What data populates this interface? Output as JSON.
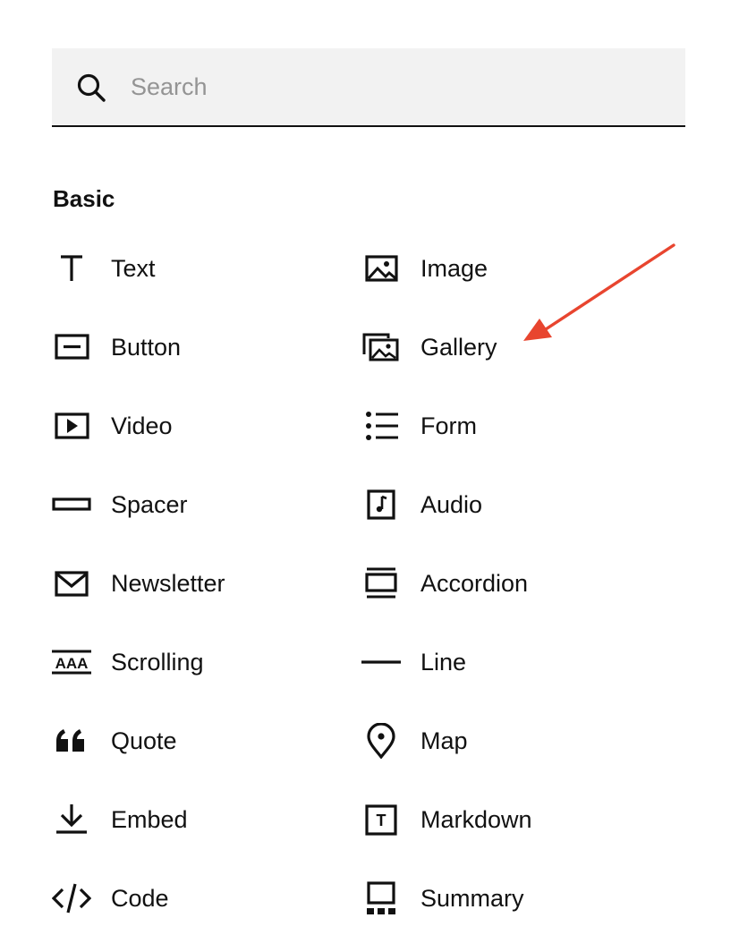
{
  "search": {
    "placeholder": "Search",
    "value": ""
  },
  "section": {
    "title": "Basic"
  },
  "blocks": {
    "text": {
      "label": "Text",
      "icon": "text-icon"
    },
    "image": {
      "label": "Image",
      "icon": "image-icon"
    },
    "button": {
      "label": "Button",
      "icon": "button-icon"
    },
    "gallery": {
      "label": "Gallery",
      "icon": "gallery-icon"
    },
    "video": {
      "label": "Video",
      "icon": "video-icon"
    },
    "form": {
      "label": "Form",
      "icon": "form-icon"
    },
    "spacer": {
      "label": "Spacer",
      "icon": "spacer-icon"
    },
    "audio": {
      "label": "Audio",
      "icon": "audio-icon"
    },
    "newsletter": {
      "label": "Newsletter",
      "icon": "newsletter-icon"
    },
    "accordion": {
      "label": "Accordion",
      "icon": "accordion-icon"
    },
    "scrolling": {
      "label": "Scrolling",
      "icon": "scrolling-icon",
      "icon_text": "AAA"
    },
    "line": {
      "label": "Line",
      "icon": "line-icon"
    },
    "quote": {
      "label": "Quote",
      "icon": "quote-icon"
    },
    "map": {
      "label": "Map",
      "icon": "map-pin-icon"
    },
    "embed": {
      "label": "Embed",
      "icon": "embed-icon"
    },
    "markdown": {
      "label": "Markdown",
      "icon": "markdown-icon",
      "icon_text": "T"
    },
    "code": {
      "label": "Code",
      "icon": "code-icon",
      "icon_text": "</>"
    },
    "summary": {
      "label": "Summary",
      "icon": "summary-icon"
    }
  },
  "annotation": {
    "type": "arrow",
    "color": "#e8452f",
    "points_to": "gallery"
  },
  "colors": {
    "text": "#111111",
    "search_bg": "#f2f2f2",
    "placeholder": "#949494",
    "arrow": "#e8452f"
  }
}
